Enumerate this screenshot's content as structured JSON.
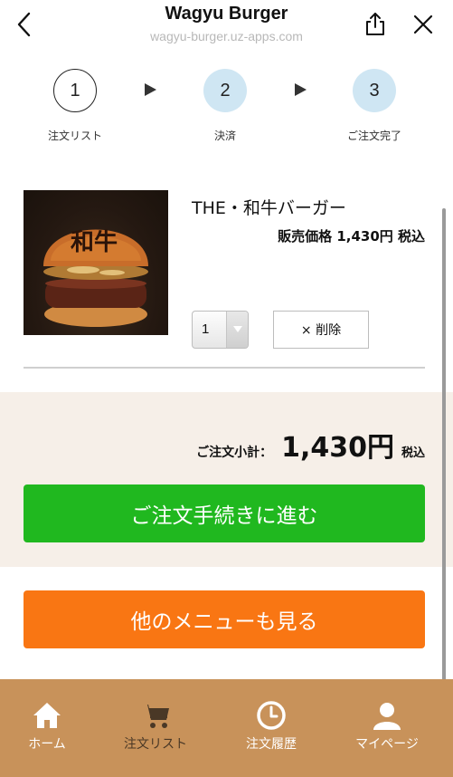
{
  "header": {
    "title": "Wagyu Burger",
    "subtitle": "wagyu-burger.uz-apps.com"
  },
  "steps": [
    {
      "number": "1",
      "label": "注文リスト"
    },
    {
      "number": "2",
      "label": "決済"
    },
    {
      "number": "3",
      "label": "ご注文完了"
    }
  ],
  "product": {
    "name": "THE・和牛バーガー",
    "price_text": "販売価格 1,430円 税込",
    "quantity": "1",
    "delete_label": "× 削除",
    "image_text": "和牛"
  },
  "summary": {
    "subtotal_label": "ご注文小計：",
    "subtotal_value": "1,430円",
    "tax_label": "税込",
    "checkout_label": "ご注文手続きに進む"
  },
  "other_menu_label": "他のメニューも見る",
  "nav": {
    "home": "ホーム",
    "cart": "注文リスト",
    "history": "注文履歴",
    "mypage": "マイページ"
  },
  "colors": {
    "checkout": "#20b81f",
    "menu": "#f97613",
    "nav_bg": "#c8925a",
    "summary_bg": "#f6efe8",
    "step_active": "#cfe6f3"
  }
}
